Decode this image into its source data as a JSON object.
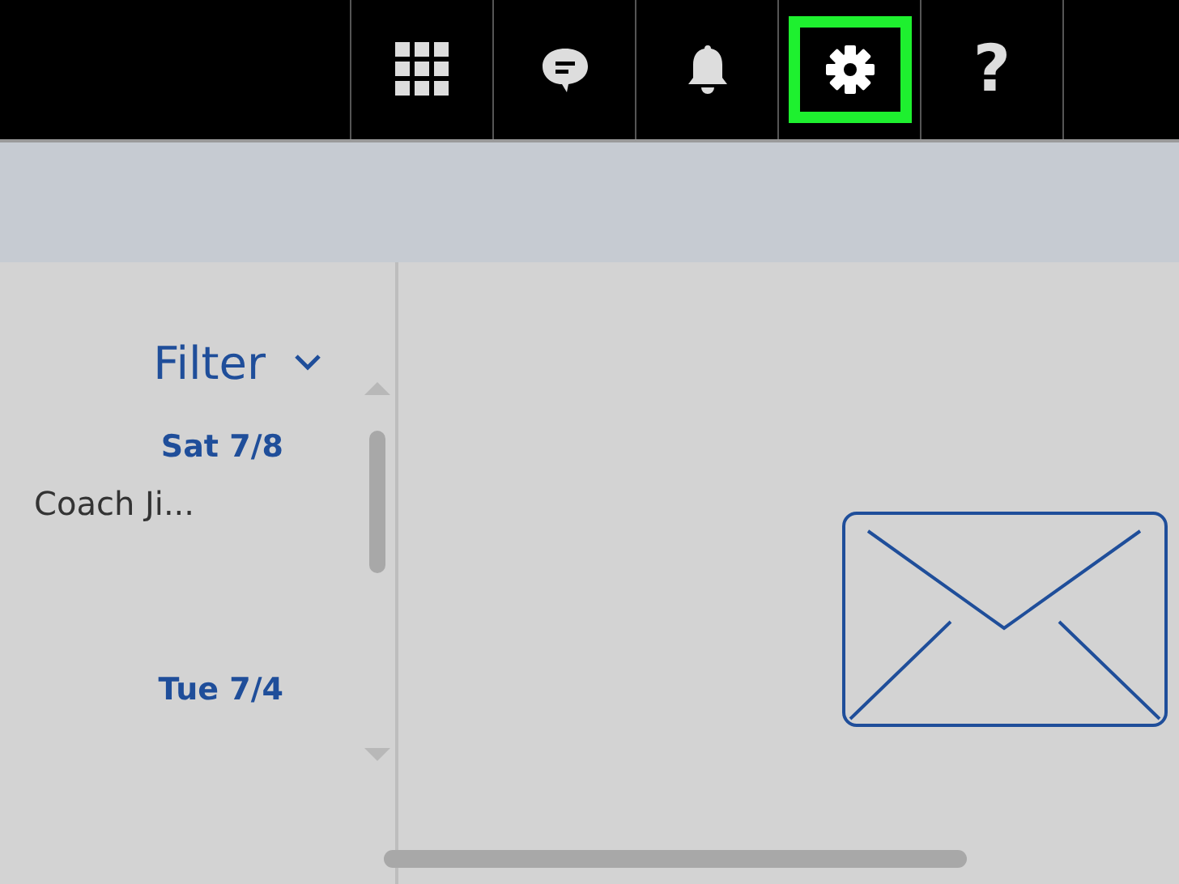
{
  "toolbar": {
    "buttons": [
      {
        "kind": "apps",
        "highlighted": false
      },
      {
        "kind": "chat",
        "highlighted": false
      },
      {
        "kind": "bell",
        "highlighted": false
      },
      {
        "kind": "gear",
        "highlighted": true
      },
      {
        "kind": "help",
        "glyph": "?",
        "highlighted": false
      }
    ]
  },
  "filter": {
    "label": "Filter"
  },
  "messages": [
    {
      "date": "Sat 7/8",
      "sender": "Coach Ji..."
    },
    {
      "date": "Tue 7/4"
    }
  ]
}
